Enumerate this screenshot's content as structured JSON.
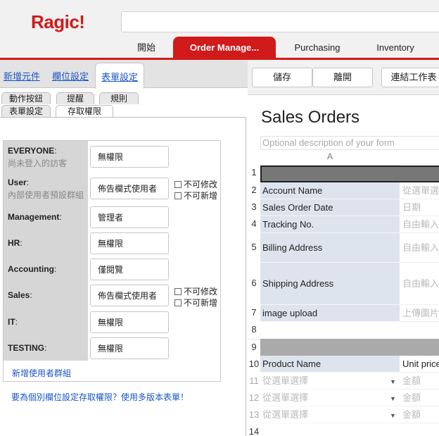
{
  "header": {
    "logo": "Ragic!",
    "tabs": [
      "開始",
      "Order Manage...",
      "Purchasing",
      "Inventory"
    ]
  },
  "left": {
    "toplinks": [
      "新增元件",
      "欄位設定",
      "表單設定"
    ],
    "subtabs_row1": [
      "動作按鈕",
      "提醒",
      "規則"
    ],
    "subtabs_row2": [
      "表單設定",
      "存取權限"
    ],
    "groups": [
      {
        "name": "EVERYONE",
        "sub": "尚未登入的訪客",
        "perm": "無權限"
      },
      {
        "name": "User",
        "sub": "內部使用者預設群組",
        "perm": "佈告欄式使用者"
      },
      {
        "name": "Management",
        "sub": "",
        "perm": "管理者"
      },
      {
        "name": "HR",
        "sub": "",
        "perm": "無權限"
      },
      {
        "name": "Accounting",
        "sub": "",
        "perm": "僅閱覽"
      },
      {
        "name": "Sales",
        "sub": "",
        "perm": "佈告欄式使用者"
      },
      {
        "name": "IT",
        "sub": "",
        "perm": "無權限"
      },
      {
        "name": "TESTING",
        "sub": "",
        "perm": "無權限"
      }
    ],
    "checkbox_labels": [
      "不可修改",
      "不可新增"
    ],
    "add_group": "新增使用者群組",
    "bottom_link": "要為個別欄位設定存取權限？使用多版本表單！"
  },
  "right": {
    "buttons": [
      "儲存",
      "離開",
      "連結工作表"
    ],
    "title": "Sales Orders",
    "description_placeholder": "Optional description of your form",
    "column_header": "A",
    "rows": [
      {
        "num": "1",
        "a": "",
        "b": ""
      },
      {
        "num": "2",
        "a": "Account Name",
        "b": "從選單選"
      },
      {
        "num": "3",
        "a": "Sales Order Date",
        "b": "日期"
      },
      {
        "num": "4",
        "a": "Tracking No.",
        "b": "自由輸入"
      },
      {
        "num": "5",
        "a": "Billing Address",
        "b": "自由輸入"
      },
      {
        "num": "6",
        "a": "Shipping Address",
        "b": "自由輸入"
      },
      {
        "num": "7",
        "a": "image upload",
        "b": "上傳圖片"
      },
      {
        "num": "8",
        "a": "",
        "b": ""
      },
      {
        "num": "9",
        "a": "",
        "b": ""
      },
      {
        "num": "10",
        "a": "Product Name",
        "b": "Unit price"
      },
      {
        "num": "11",
        "a": "從選單選擇",
        "b": "金額"
      },
      {
        "num": "12",
        "a": "從選單選擇",
        "b": "金額"
      },
      {
        "num": "13",
        "a": "從選單選擇",
        "b": "金額"
      },
      {
        "num": "14",
        "a": "",
        "b": ""
      }
    ]
  }
}
